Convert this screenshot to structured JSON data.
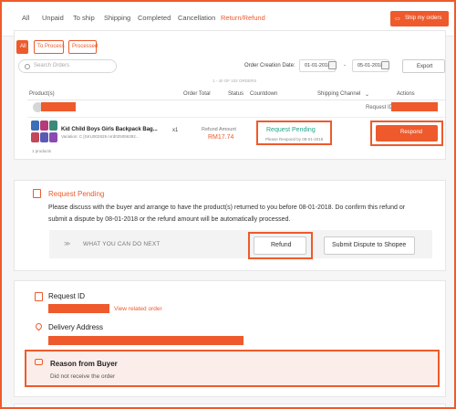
{
  "tabs": [
    "All",
    "Unpaid",
    "To ship",
    "Shipping",
    "Completed",
    "Cancellation",
    "Return/Refund"
  ],
  "ship_button": "Ship my orders",
  "filters": {
    "all": "All",
    "to_process": "To Process",
    "processed": "Processed"
  },
  "search": {
    "placeholder": "Search Orders"
  },
  "date_filter": {
    "label": "Order Creation Date:",
    "from": "01-01-2018",
    "to": "05-01-2018",
    "separator": "-"
  },
  "export_label": "Export",
  "range_note": "1 - 40 OF 102 ORDERS",
  "table": {
    "headers": [
      "Product(s)",
      "Order Total",
      "Status",
      "Countdown",
      "Shipping Channel",
      "Actions"
    ],
    "request_id_label": "Request ID",
    "product_name": "Kid Child Boys Girls Backpack Bag...",
    "variation": "Variation: C [SKU002829 nrrd025056392...",
    "products_count": "1 products",
    "qty": "x1",
    "refund_label": "Refund Amount",
    "refund_amount": "RM17.74",
    "status": "Request Pending",
    "status_sub": "Please Respond by 08-01-2018",
    "respond": "Respond"
  },
  "pending_panel": {
    "title": "Request Pending",
    "line1": "Please discuss with the buyer and arrange to have the product(s) returned to you before 08-01-2018. Do confirm this refund or",
    "line2": "submit a dispute by 08-01-2018 or the refund amount will be automatically processed.",
    "next_label": "WHAT YOU CAN DO NEXT",
    "refund_button": "Refund",
    "dispute_button": "Submit Dispute to Shopee"
  },
  "details_panel": {
    "request_id": "Request ID",
    "view_order": "View related order",
    "delivery": "Delivery Address",
    "reason_title": "Reason from Buyer",
    "reason_text": "Did not receive the order"
  },
  "colors": {
    "accent": "#ee5a2c",
    "status_green": "#20a58a"
  }
}
